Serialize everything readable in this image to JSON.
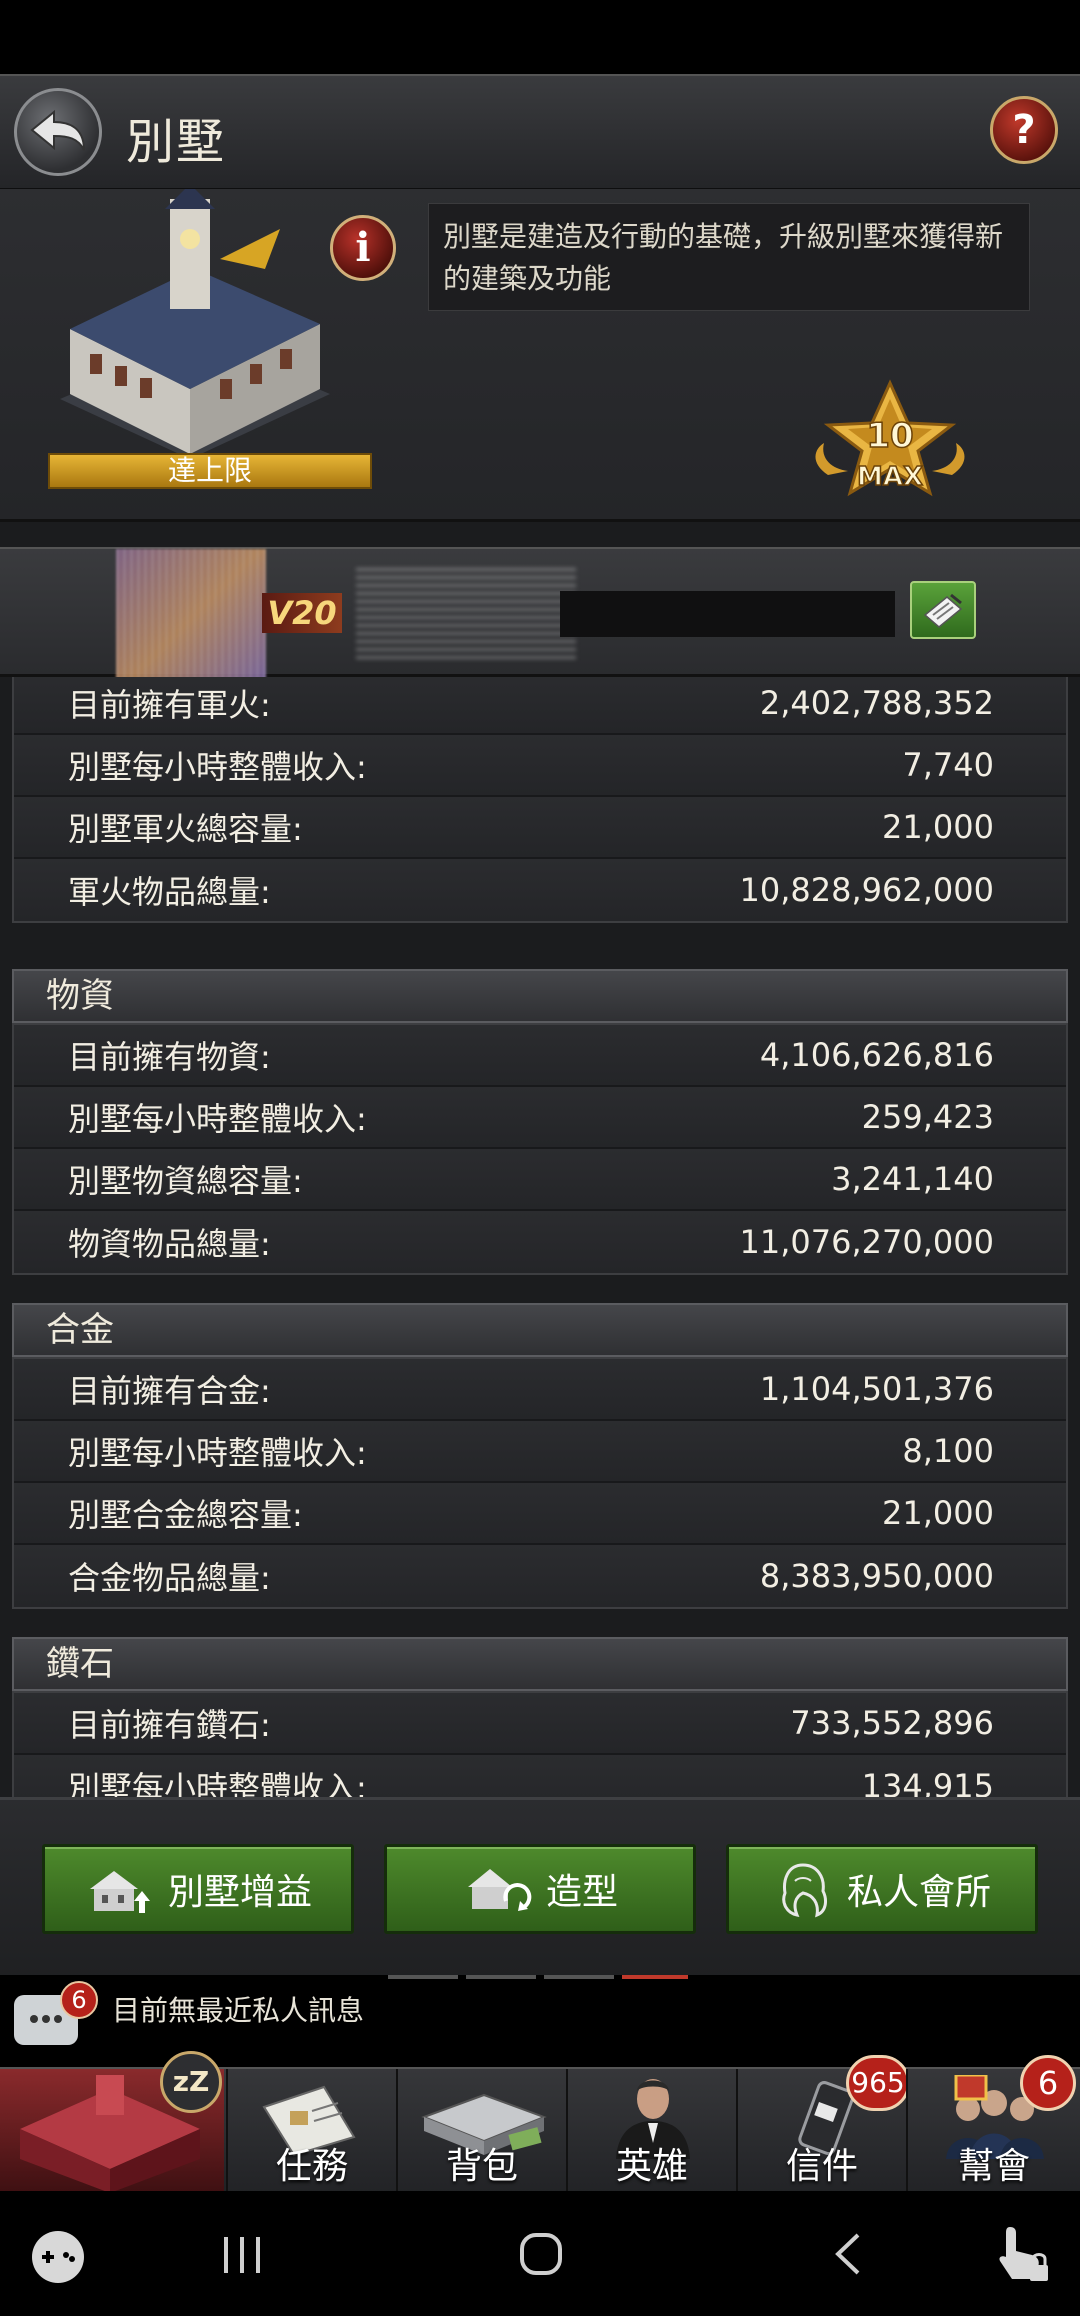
{
  "header": {
    "title": "別墅",
    "help_label": "?"
  },
  "info": {
    "limit_label": "達上限",
    "info_icon": "i",
    "description": "別墅是建造及行動的基礎，升級別墅來獲得新的建築及功能",
    "max_level": "10",
    "max_text": "MAX"
  },
  "player": {
    "vip_label": "V20"
  },
  "sections": [
    {
      "title": "",
      "rows": [
        {
          "label": "目前擁有軍火:",
          "value": "2,402,788,352"
        },
        {
          "label": "別墅每小時整體收入:",
          "value": "7,740"
        },
        {
          "label": "別墅軍火總容量:",
          "value": "21,000"
        },
        {
          "label": "軍火物品總量:",
          "value": "10,828,962,000"
        }
      ]
    },
    {
      "title": "物資",
      "rows": [
        {
          "label": "目前擁有物資:",
          "value": "4,106,626,816"
        },
        {
          "label": "別墅每小時整體收入:",
          "value": "259,423"
        },
        {
          "label": "別墅物資總容量:",
          "value": "3,241,140"
        },
        {
          "label": "物資物品總量:",
          "value": "11,076,270,000"
        }
      ]
    },
    {
      "title": "合金",
      "rows": [
        {
          "label": "目前擁有合金:",
          "value": "1,104,501,376"
        },
        {
          "label": "別墅每小時整體收入:",
          "value": "8,100"
        },
        {
          "label": "別墅合金總容量:",
          "value": "21,000"
        },
        {
          "label": "合金物品總量:",
          "value": "8,383,950,000"
        }
      ]
    },
    {
      "title": "鑽石",
      "rows": [
        {
          "label": "目前擁有鑽石:",
          "value": "733,552,896"
        },
        {
          "label": "別墅每小時整體收入:",
          "value": "134,915"
        }
      ]
    }
  ],
  "actions": {
    "buff_label": "別墅增益",
    "style_label": "造型",
    "club_label": "私人會所"
  },
  "messages": {
    "badge": "6",
    "text": "目前無最近私人訊息"
  },
  "nav": {
    "home_badge": "zZ",
    "tasks": "任務",
    "bag": "背包",
    "heroes": "英雄",
    "mail": "信件",
    "mail_badge": "965",
    "guild": "幫會",
    "guild_badge": "6"
  },
  "colors": {
    "accent_gold": "#e7b536",
    "button_green": "#4e8a2c",
    "badge_red": "#b5211a"
  }
}
